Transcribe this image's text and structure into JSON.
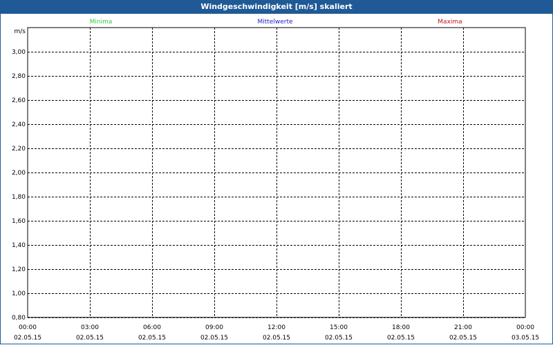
{
  "window": {
    "title": "Windgeschwindigkeit [m/s] skaliert"
  },
  "legend": {
    "items": [
      {
        "label": "Minima",
        "color": "#2ecc40"
      },
      {
        "label": "Mittelwerte",
        "color": "#2020c0"
      },
      {
        "label": "Maxima",
        "color": "#c0141e"
      }
    ]
  },
  "chart_data": {
    "type": "line",
    "title": "Windgeschwindigkeit [m/s] skaliert",
    "ylabel": "m/s",
    "xlabel": "",
    "ylim": [
      0.8,
      3.2
    ],
    "grid": true,
    "legend_position": "top",
    "yticks": [
      0.8,
      1.0,
      1.2,
      1.4,
      1.6,
      1.8,
      2.0,
      2.2,
      2.4,
      2.6,
      2.8,
      3.0
    ],
    "ytick_labels": [
      "0,80",
      "1,00",
      "1,20",
      "1,40",
      "1,60",
      "1,80",
      "2,00",
      "2,20",
      "2,40",
      "2,60",
      "2,80",
      "3,00"
    ],
    "xticks": [
      {
        "time": "00:00",
        "date": "02.05.15"
      },
      {
        "time": "03:00",
        "date": "02.05.15"
      },
      {
        "time": "06:00",
        "date": "02.05.15"
      },
      {
        "time": "09:00",
        "date": "02.05.15"
      },
      {
        "time": "12:00",
        "date": "02.05.15"
      },
      {
        "time": "15:00",
        "date": "02.05.15"
      },
      {
        "time": "18:00",
        "date": "02.05.15"
      },
      {
        "time": "21:00",
        "date": "02.05.15"
      },
      {
        "time": "00:00",
        "date": "03.05.15"
      }
    ],
    "series": [
      {
        "name": "Minima",
        "color": "#2ecc40",
        "values": []
      },
      {
        "name": "Mittelwerte",
        "color": "#2020c0",
        "values": []
      },
      {
        "name": "Maxima",
        "color": "#c0141e",
        "values": []
      }
    ]
  }
}
